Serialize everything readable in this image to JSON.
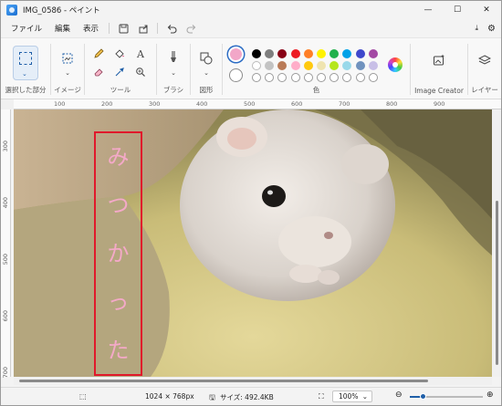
{
  "window": {
    "title": "IMG_0586 - ペイント"
  },
  "menu": {
    "file": "ファイル",
    "edit": "編集",
    "view": "表示"
  },
  "ribbon": {
    "groups": {
      "selection": "選択した部分",
      "image": "イメージ",
      "tools": "ツール",
      "brushes": "ブラシ",
      "shapes": "図形",
      "colors": "色",
      "image_creator": "Image Creator",
      "layers": "レイヤー"
    },
    "text_tool_glyph": "A",
    "palette_row1": [
      "#000000",
      "#7f7f7f",
      "#880015",
      "#ed1c24",
      "#ff7f27",
      "#fff200",
      "#22b14c",
      "#00a2e8",
      "#3f48cc",
      "#a349a4"
    ],
    "palette_row2": [
      "#ffffff",
      "#c3c3c3",
      "#b97a57",
      "#ffaec9",
      "#ffc90e",
      "#efe4b0",
      "#b5e61d",
      "#99d9ea",
      "#7092be",
      "#c8bfe7"
    ],
    "current_color": "#f2a7c8"
  },
  "ruler": {
    "h_ticks": [
      "100",
      "200",
      "300",
      "400",
      "500",
      "600",
      "700",
      "800",
      "900"
    ],
    "v_ticks": [
      "300",
      "400",
      "500",
      "600",
      "700"
    ]
  },
  "canvas": {
    "text_chars": [
      "み",
      "つ",
      "か",
      "っ",
      "た"
    ],
    "text_color": "#f4a9c8",
    "box_color": "#e0192b"
  },
  "status": {
    "dimensions": "1024 × 768px",
    "size": "サイズ: 492.4KB",
    "zoom": "100%"
  }
}
